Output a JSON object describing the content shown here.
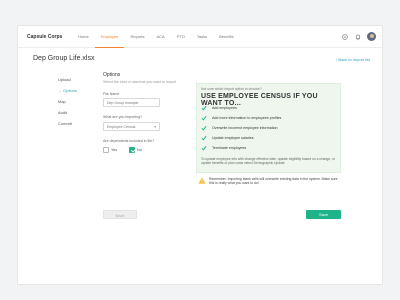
{
  "app": {
    "brand": "Capsule Corps"
  },
  "nav": {
    "items": [
      {
        "label": "Home"
      },
      {
        "label": "Employee"
      },
      {
        "label": "Reports"
      },
      {
        "label": "ACA"
      },
      {
        "label": "PTO"
      },
      {
        "label": "Tasks"
      },
      {
        "label": "Benefits"
      }
    ],
    "active": "Employee"
  },
  "page": {
    "title": "Dep Group Life.xlsx",
    "back_link": "Back to import list"
  },
  "steps": {
    "items": [
      {
        "label": "Upload"
      },
      {
        "label": "→ Options"
      },
      {
        "label": "Map"
      },
      {
        "label": "Audit"
      },
      {
        "label": "Commit"
      }
    ],
    "active": "→ Options"
  },
  "options": {
    "title": "Options",
    "description": "Select the kind of data that you want to import",
    "file_name_label": "File Name",
    "file_name_placeholder": "Dep Group example",
    "importing_label": "What are you importing?",
    "importing_value": "Employee Census",
    "dependents_label": "Are dependents included in file?",
    "yes_label": "Yes",
    "no_label": "No",
    "yes_checked": false,
    "no_checked": true
  },
  "info": {
    "question": "Not sure which import option to choose?",
    "heading": "USE EMPLOYEE CENSUS IF YOU WANT TO...",
    "items": [
      {
        "label": "Add employees"
      },
      {
        "label": "Add more information to employees profiles"
      },
      {
        "label": "Overwrite incorrect employee information"
      },
      {
        "label": "Update employee salaries"
      },
      {
        "label": "Terminate employees"
      }
    ],
    "note": "To update employee info with change effective date, update eligibility based on a change, or update benefits or plan costs select Demographic Update"
  },
  "warning": {
    "text": "Remember: Importing blank cells will overwrite existing data in the system. Make sure this is really what you want to do!"
  },
  "actions": {
    "back_label": "Back",
    "save_label": "Save"
  },
  "colors": {
    "accent": "#f0832c",
    "link": "#29a2c4",
    "success": "#1fb38a",
    "info_bg": "#eef6ee",
    "warning": "#f5b82e"
  }
}
